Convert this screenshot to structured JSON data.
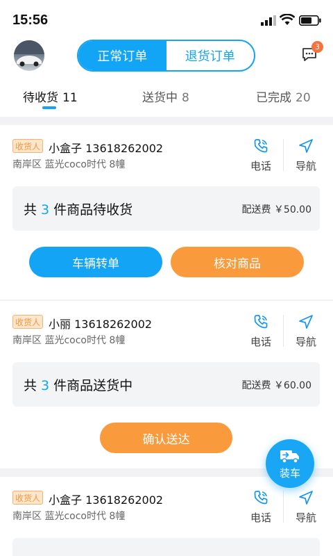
{
  "status": {
    "time": "15:56"
  },
  "header": {
    "segments": [
      "正常订单",
      "退货订单"
    ],
    "message_badge": "3"
  },
  "tabs": [
    {
      "label": "待收货",
      "count": "11"
    },
    {
      "label": "送货中",
      "count": "8"
    },
    {
      "label": "已完成",
      "count": "20"
    }
  ],
  "orders": [
    {
      "tag": "收货人",
      "receiver": "小盒子 13618262002",
      "address": "南岸区 蓝光coco时代 8幢",
      "phone_label": "电话",
      "nav_label": "导航",
      "summary_prefix": "共",
      "count": "3",
      "summary_suffix": "件商品待收货",
      "fee": "配送费 ￥50.00",
      "buttons": [
        "车辆转单",
        "核对商品"
      ]
    },
    {
      "tag": "收货人",
      "receiver": "小丽 13618262002",
      "address": "南岸区 蓝光coco时代 8幢",
      "phone_label": "电话",
      "nav_label": "导航",
      "summary_prefix": "共",
      "count": "3",
      "summary_suffix": "件商品送货中",
      "fee": "配送费 ￥60.00",
      "buttons": [
        "确认送达"
      ]
    },
    {
      "tag": "收货人",
      "receiver": "小盒子 13618262002",
      "address": "南岸区 蓝光coco时代 8幢",
      "phone_label": "电话",
      "nav_label": "导航"
    }
  ],
  "fab": {
    "label": "装车"
  },
  "colors": {
    "accent": "#12a4f5",
    "orange": "#f99b3c",
    "tag_bg": "#ffe6cc"
  }
}
